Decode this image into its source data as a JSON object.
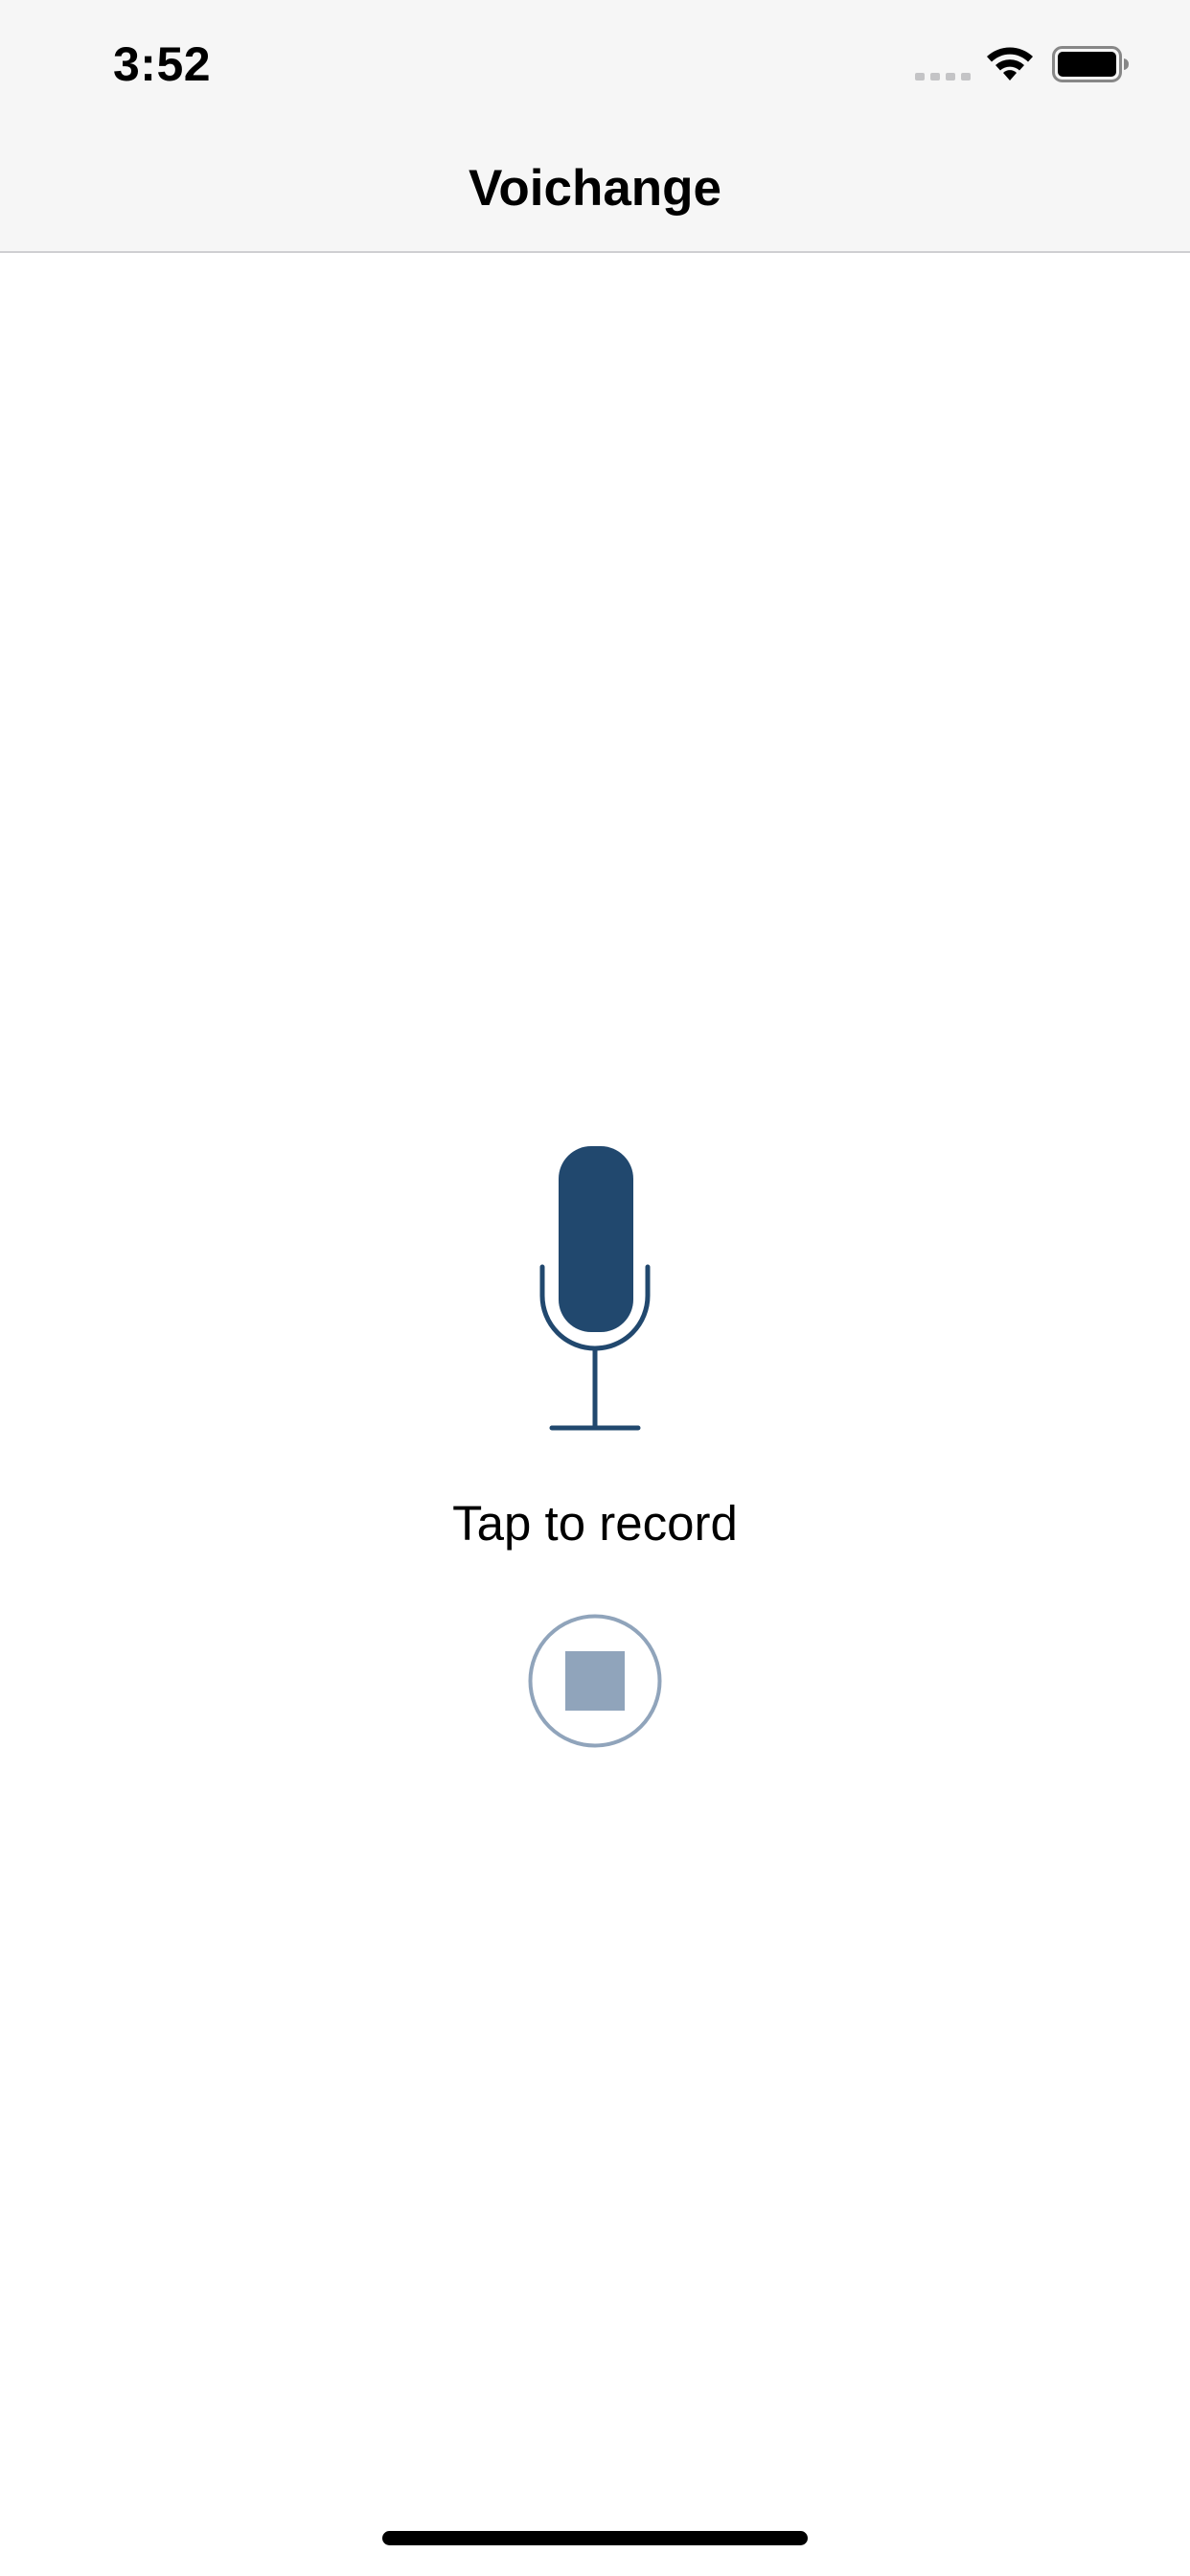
{
  "status_bar": {
    "time": "3:52"
  },
  "nav": {
    "title": "Voichange"
  },
  "main": {
    "record_label": "Tap to record"
  },
  "colors": {
    "accent": "#21486e",
    "stop_disabled_fill": "#90a4bb",
    "stop_disabled_ring": "#90a4bb",
    "header_bg": "#f6f6f6"
  },
  "icons": {
    "signal": "cellular-signal-icon",
    "wifi": "wifi-icon",
    "battery": "battery-icon",
    "record": "microphone-icon",
    "stop": "stop-icon"
  }
}
